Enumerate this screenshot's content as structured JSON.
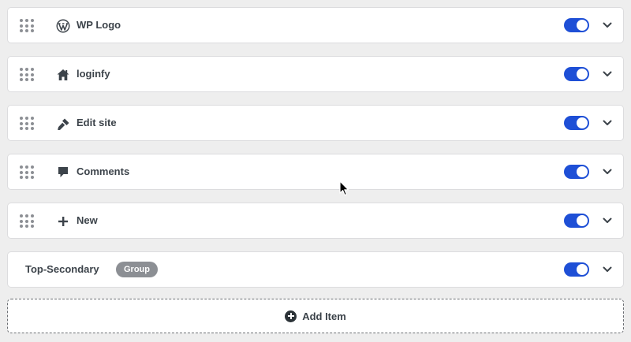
{
  "colors": {
    "toggle_on": "#1e4fd6",
    "badge_bg": "#8c8f94",
    "text": "#3c434a"
  },
  "items": [
    {
      "label": "WP Logo",
      "icon": "wordpress-icon",
      "enabled": true
    },
    {
      "label": "loginfy",
      "icon": "home-icon",
      "enabled": true
    },
    {
      "label": "Edit site",
      "icon": "brush-icon",
      "enabled": true
    },
    {
      "label": "Comments",
      "icon": "comment-icon",
      "enabled": true
    },
    {
      "label": "New",
      "icon": "plus-icon",
      "enabled": true
    }
  ],
  "group": {
    "label": "Top-Secondary",
    "badge": "Group",
    "enabled": true
  },
  "add_item": {
    "label": "Add Item",
    "icon": "plus-circle-icon"
  }
}
